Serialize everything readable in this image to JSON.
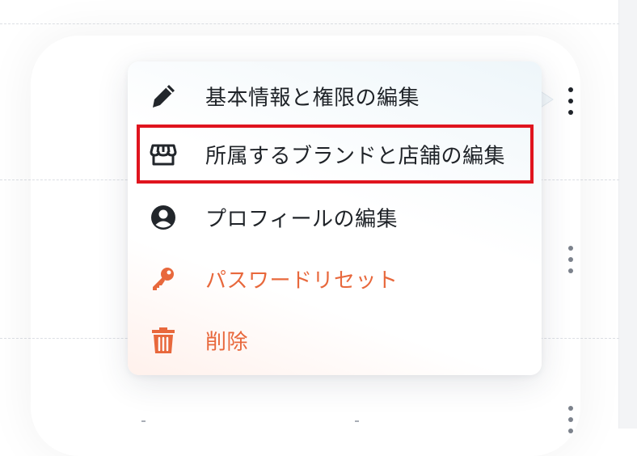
{
  "menu": {
    "items": [
      {
        "label": "基本情報と権限の編集",
        "icon": "pencil-icon"
      },
      {
        "label": "所属するブランドと店舗の編集",
        "icon": "store-icon"
      },
      {
        "label": "プロフィールの編集",
        "icon": "user-circle-icon"
      },
      {
        "label": "パスワードリセット",
        "icon": "key-icon"
      },
      {
        "label": "削除",
        "icon": "trash-icon"
      }
    ]
  },
  "colors": {
    "text": "#1f2328",
    "danger": "#e8683c",
    "highlight": "#e0141e",
    "kebab_active": "#20242a",
    "kebab_inactive": "#7c828c"
  }
}
